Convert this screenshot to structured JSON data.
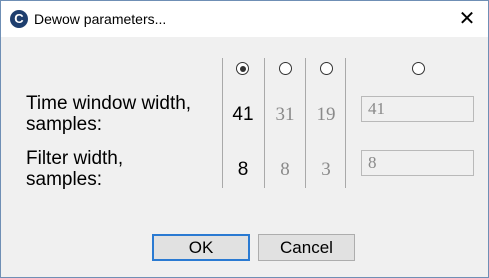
{
  "window": {
    "title": "Dewow parameters...",
    "close_glyph": "✕",
    "icon_letter": "C"
  },
  "options": [
    {
      "selected": true,
      "time_window_width": "41",
      "filter_width": "8"
    },
    {
      "selected": false,
      "time_window_width": "31",
      "filter_width": "8"
    },
    {
      "selected": false,
      "time_window_width": "19",
      "filter_width": "3"
    },
    {
      "selected": false,
      "time_window_width": "41",
      "filter_width": "8"
    }
  ],
  "labels": {
    "time_window_line1": "Time window width,",
    "time_window_line2": "samples:",
    "filter_line1": "Filter width,",
    "filter_line2": "samples:"
  },
  "buttons": {
    "ok_label": "OK",
    "cancel_label": "Cancel"
  },
  "colors": {
    "accent": "#2a7ad2",
    "frame": "#6f8fb5",
    "dim_text": "#8a8a8a"
  }
}
